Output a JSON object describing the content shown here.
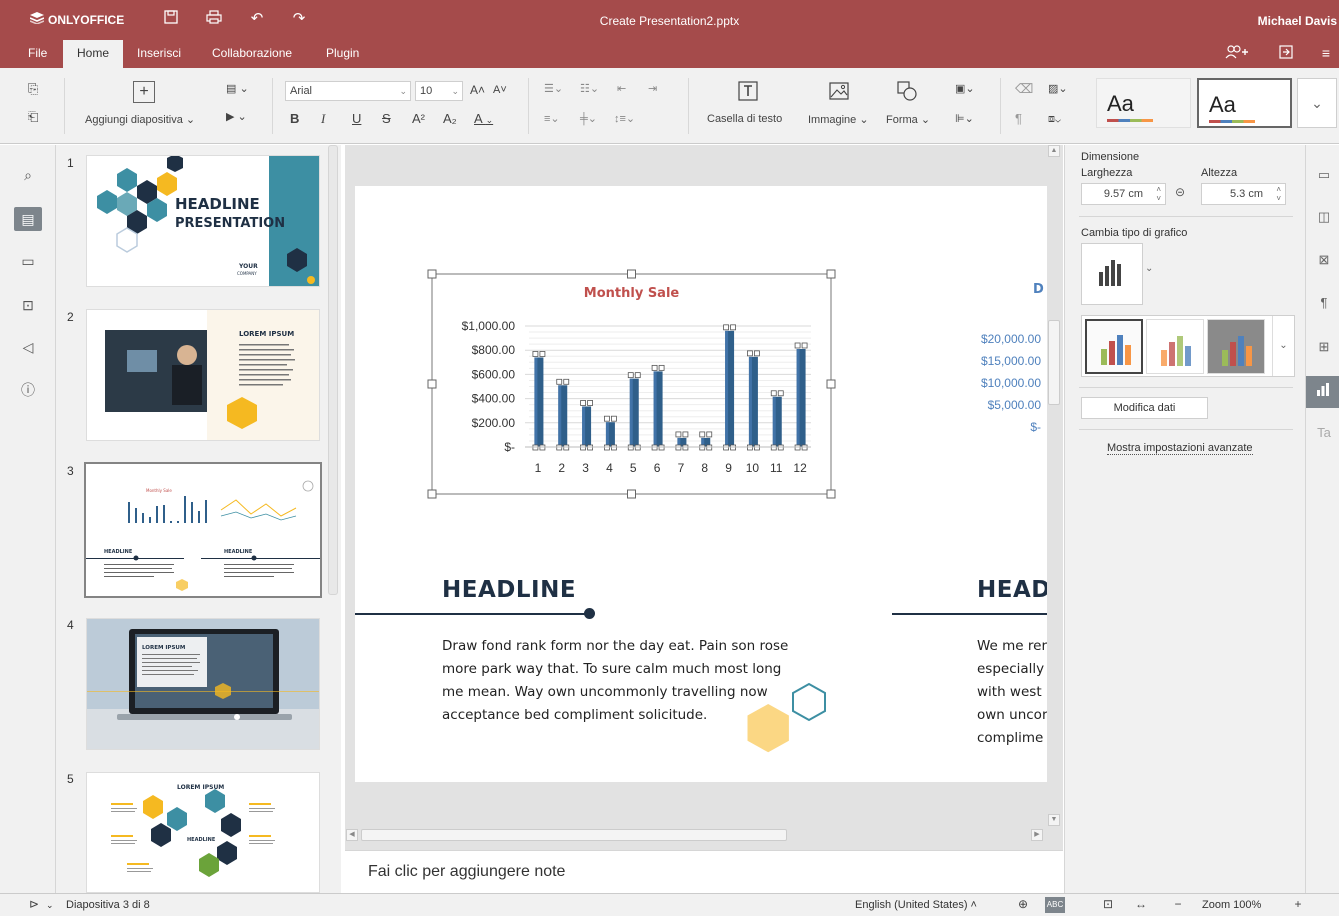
{
  "window": {
    "brand": "ONLYOFFICE",
    "title": "Create Presentation2.pptx",
    "user": "Michael Davis"
  },
  "menu_tabs": [
    "File",
    "Home",
    "Inserisci",
    "Collaborazione",
    "Plugin"
  ],
  "toolbar": {
    "add_slide_label": "Aggiungi diapositiva",
    "font_name": "Arial",
    "font_size": "10",
    "textbox_label": "Casella di testo",
    "image_label": "Immagine",
    "shape_label": "Forma",
    "theme1": "Aa",
    "theme2": "Aa",
    "bold": "B",
    "italic": "I",
    "underline": "U",
    "strike": "S",
    "superscript": "A²",
    "subscript": "A₂",
    "font_color": "A"
  },
  "slides": [
    {
      "num": "1",
      "headline": "HEADLINE",
      "headline2": "PRESENTATION",
      "footer": "YOUR",
      "footer2": "COMPANY"
    },
    {
      "num": "2",
      "headline": "LOREM IPSUM"
    },
    {
      "num": "3",
      "headline": "HEADLINE",
      "headline2": "HEADLINE"
    },
    {
      "num": "4",
      "headline": "LOREM IPSUM"
    },
    {
      "num": "5",
      "headline": "LOREM IPSUM",
      "center": "HEADLINE"
    }
  ],
  "slide": {
    "headline_left": "HEADLINE",
    "body_left": "Draw fond rank form nor the day eat. Pain son rose more park way that. To sure calm much most long me mean. Way own uncommonly travelling now acceptance bed compliment solicitude.",
    "headline_right": "HEAD",
    "body_right_lines": [
      "We me rer",
      "especially",
      "with west",
      "own uncor",
      "complime"
    ],
    "right_chart_title_partial": "D",
    "right_chart_ticks": [
      "$20,000.00",
      "$15,000.00",
      "$10,000.00",
      "$5,000.00",
      "$-"
    ]
  },
  "chart_data": {
    "type": "bar",
    "title": "Monthly Sale",
    "categories": [
      "1",
      "2",
      "3",
      "4",
      "5",
      "6",
      "7",
      "8",
      "9",
      "10",
      "11",
      "12"
    ],
    "values": [
      740,
      510,
      335,
      205,
      565,
      625,
      75,
      75,
      960,
      745,
      415,
      810
    ],
    "ylim": [
      0,
      1000
    ],
    "ytick_labels": [
      "$1,000.00",
      "$800.00",
      "$600.00",
      "$400.00",
      "$200.00",
      "$-"
    ],
    "ytick_values": [
      1000,
      800,
      600,
      400,
      200,
      0
    ],
    "xlabel": "",
    "ylabel": "",
    "grid": true,
    "bar_color": "#2f5f8a"
  },
  "right_panel": {
    "size_title": "Dimensione",
    "width_label": "Larghezza",
    "height_label": "Altezza",
    "width_value": "9.57 cm",
    "height_value": "5.3 cm",
    "chart_type_title": "Cambia tipo di grafico",
    "edit_data": "Modifica dati",
    "advanced": "Mostra impostazioni avanzate"
  },
  "notes_placeholder": "Fai clic per aggiungere note",
  "status": {
    "slide_of": "Diapositiva 3 di 8",
    "language": "English (United States)",
    "zoom": "Zoom 100%"
  },
  "colors": {
    "header": "#a54b4b",
    "accent_teal": "#3d8fa3",
    "accent_yellow": "#f5b921",
    "navy": "#1f3044"
  }
}
